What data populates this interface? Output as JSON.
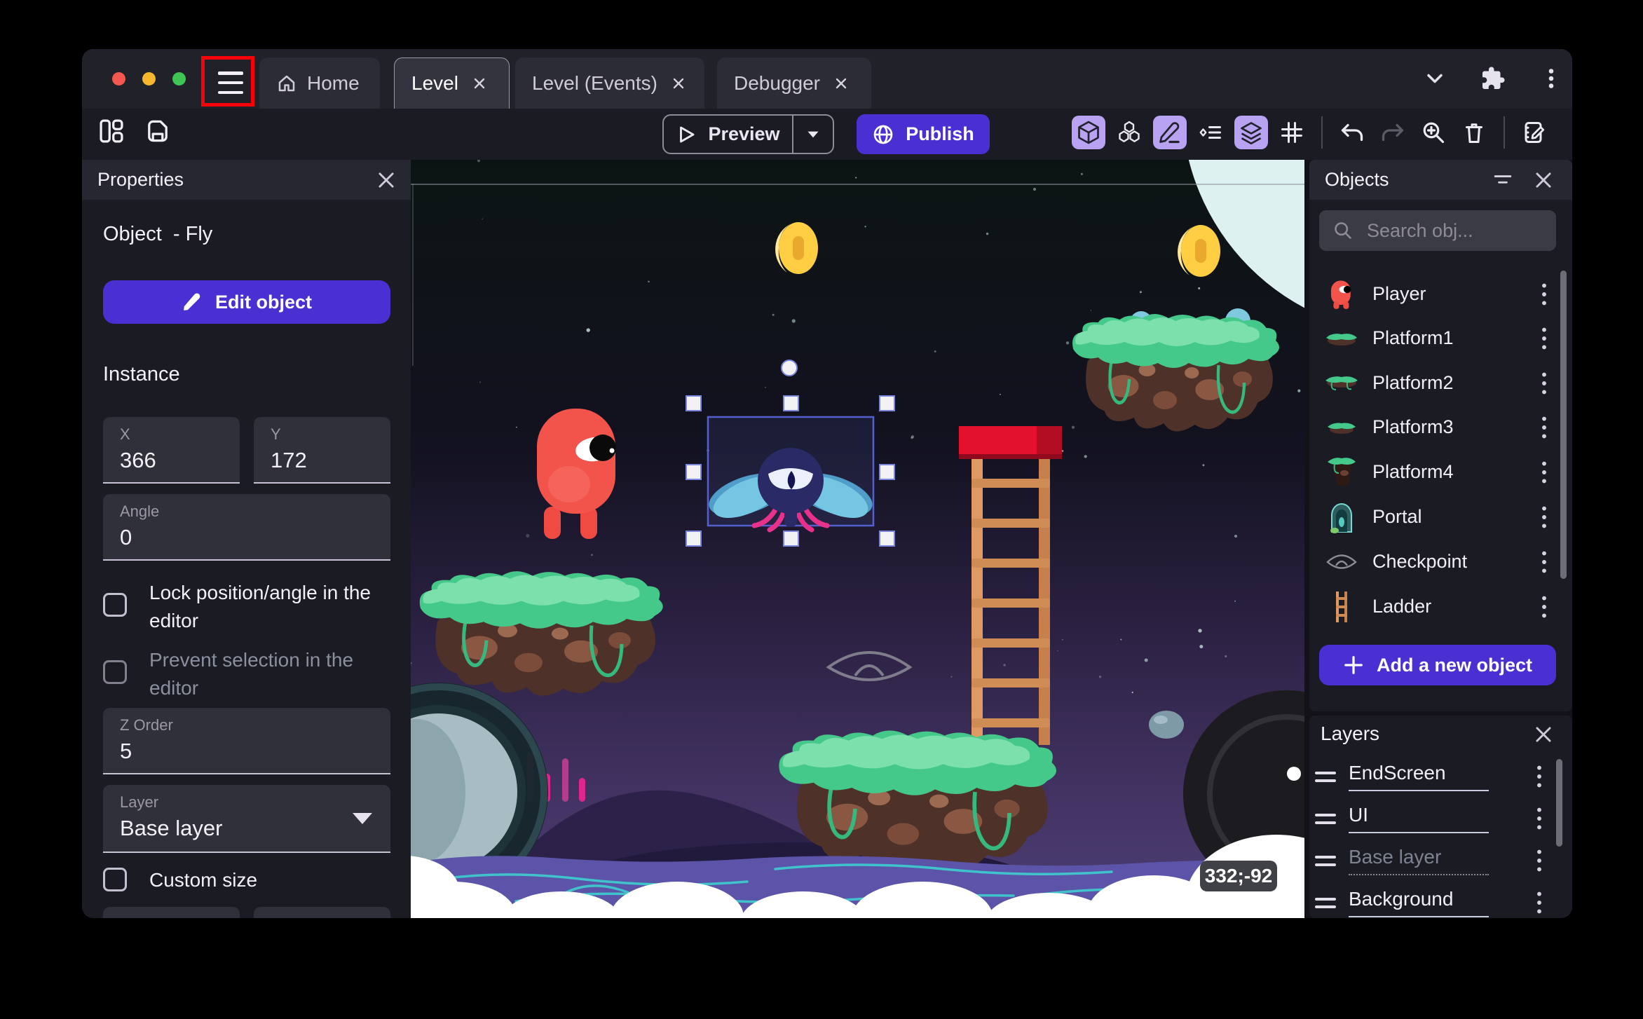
{
  "titlebar": {
    "tabs": [
      {
        "label": "Home"
      },
      {
        "label": "Level"
      },
      {
        "label": "Level (Events)"
      },
      {
        "label": "Debugger"
      }
    ]
  },
  "toolbar": {
    "preview_label": "Preview",
    "publish_label": "Publish"
  },
  "properties_panel": {
    "title": "Properties",
    "object_label": "Object  - Fly",
    "edit_object_label": "Edit object",
    "instance_heading": "Instance",
    "fields": {
      "x": {
        "label": "X",
        "value": "366"
      },
      "y": {
        "label": "Y",
        "value": "172"
      },
      "angle": {
        "label": "Angle",
        "value": "0"
      },
      "z_order": {
        "label": "Z Order",
        "value": "5"
      },
      "layer": {
        "label": "Layer",
        "value": "Base layer"
      }
    },
    "checkboxes": {
      "lock": "Lock position/angle in the editor",
      "prevent": "Prevent selection in the editor",
      "custom_size": "Custom size"
    }
  },
  "objects_panel": {
    "title": "Objects",
    "search_placeholder": "Search obj...",
    "items": [
      {
        "name": "Player"
      },
      {
        "name": "Platform1"
      },
      {
        "name": "Platform2"
      },
      {
        "name": "Platform3"
      },
      {
        "name": "Platform4"
      },
      {
        "name": "Portal"
      },
      {
        "name": "Checkpoint"
      },
      {
        "name": "Ladder"
      }
    ],
    "add_button_label": "Add a new object"
  },
  "layers_panel": {
    "title": "Layers",
    "layers": [
      {
        "name": "EndScreen"
      },
      {
        "name": "UI"
      },
      {
        "name": "Base layer"
      },
      {
        "name": "Background"
      }
    ]
  },
  "canvas": {
    "coordinate_badge": "332;-92"
  },
  "colors": {
    "accent": "#4a2fd2",
    "active_tool_bg": "#b7a3f1",
    "annotation": "#fb0007",
    "selection_stroke": "#5560cf"
  }
}
